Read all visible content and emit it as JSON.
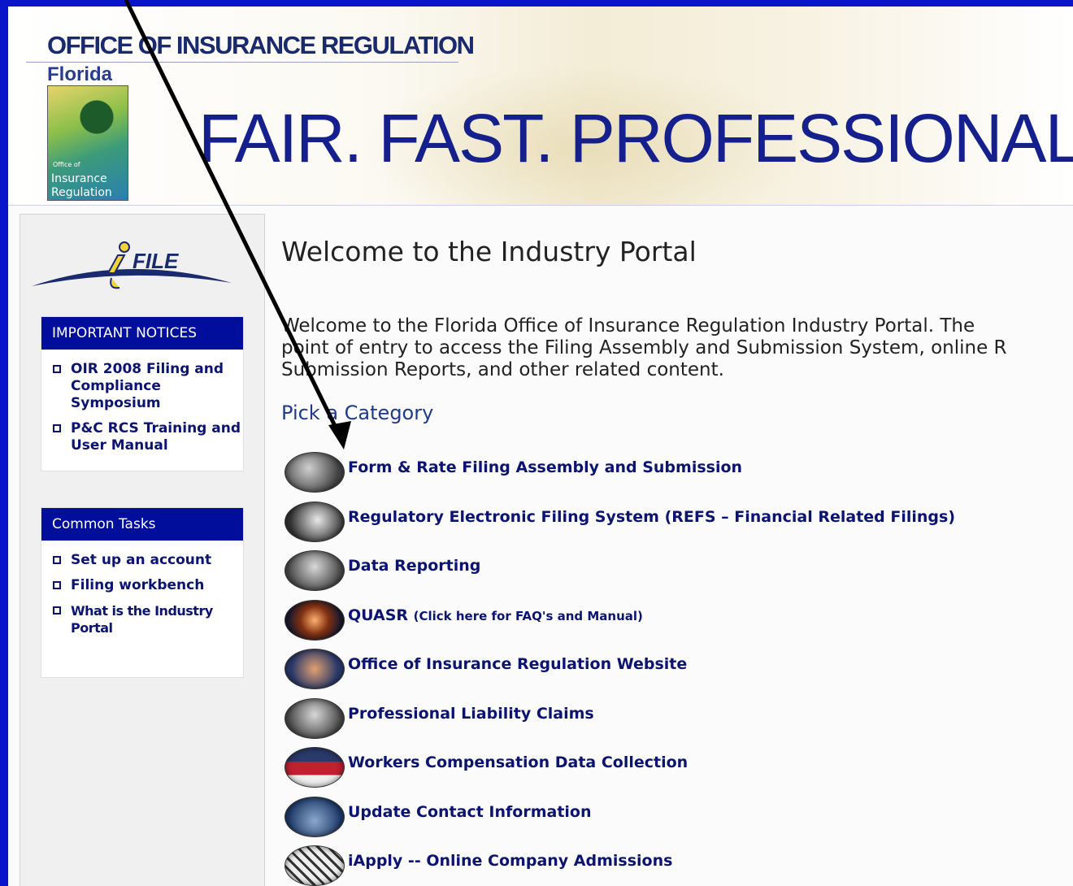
{
  "header": {
    "org_title": "OFFICE OF INSURANCE REGULATION",
    "state": "Florida",
    "logo_small": "Office of",
    "logo_line1": "Insurance",
    "logo_line2": "Regulation",
    "slogan": "FAIR. FAST. PROFESSIONAL."
  },
  "sidebar": {
    "logo_text": "FILE",
    "notices": {
      "heading": "IMPORTANT NOTICES",
      "items": [
        {
          "label": "OIR 2008 Filing and Compliance Symposium"
        },
        {
          "label": "P&C RCS Training and User Manual"
        }
      ]
    },
    "tasks": {
      "heading": "Common Tasks",
      "items": [
        {
          "label": "Set up an account"
        },
        {
          "label": "Filing workbench"
        },
        {
          "label": "What is the Industry Portal"
        }
      ]
    }
  },
  "main": {
    "welcome": "Welcome to the Industry Portal",
    "intro_lines": [
      "Welcome to the Florida Office of Insurance Regulation Industry Portal. The",
      "point of entry to access the Filing Assembly and Submission System, online R",
      "Submission Reports, and other related content."
    ],
    "pick": "Pick a Category",
    "categories": [
      {
        "label": "Form & Rate Filing Assembly and Submission",
        "suffix": ""
      },
      {
        "label": "Regulatory Electronic Filing System (REFS – Financial Related Filings)",
        "suffix": ""
      },
      {
        "label": "Data Reporting",
        "suffix": ""
      },
      {
        "label": "QUASR",
        "suffix": "(Click here for FAQ's and Manual)"
      },
      {
        "label": "Office of Insurance Regulation Website",
        "suffix": ""
      },
      {
        "label": "Professional Liability Claims",
        "suffix": ""
      },
      {
        "label": "Workers Compensation Data Collection",
        "suffix": ""
      },
      {
        "label": "Update Contact Information",
        "suffix": ""
      },
      {
        "label": "iApply -- Online Company Admissions",
        "suffix": ""
      }
    ]
  },
  "colors": {
    "frame": "#0a14c8",
    "panel_heading": "#000f9b",
    "link": "#0b1470",
    "slogan": "#16208c"
  }
}
